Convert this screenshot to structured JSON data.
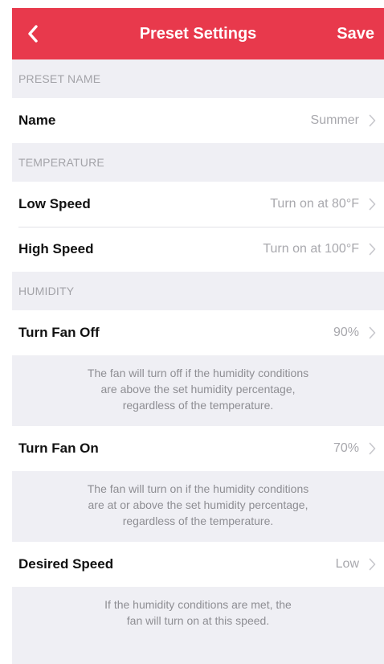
{
  "navbar": {
    "title": "Preset Settings",
    "save_label": "Save",
    "back_icon": "chevron-left-icon",
    "color": "#e8394c"
  },
  "sections": {
    "preset_name": {
      "header": "PRESET NAME",
      "name_label": "Name",
      "name_value": "Summer"
    },
    "temperature": {
      "header": "TEMPERATURE",
      "low_label": "Low Speed",
      "low_value": "Turn on at 80°F",
      "high_label": "High Speed",
      "high_value": "Turn on at 100°F"
    },
    "humidity": {
      "header": "HUMIDITY",
      "off_label": "Turn Fan Off",
      "off_value": "90%",
      "off_note_1": "The fan will turn off if the humidity conditions",
      "off_note_2": "are above the set humidity percentage,",
      "off_note_3": "regardless of the temperature.",
      "on_label": "Turn Fan On",
      "on_value": "70%",
      "on_note_1": "The fan will turn on if the humidity conditions",
      "on_note_2": "are at or above the set humidity percentage,",
      "on_note_3": "regardless of the temperature.",
      "speed_label": "Desired Speed",
      "speed_value": "Low",
      "speed_note_1": "If the humidity conditions are met, the",
      "speed_note_2": "fan will turn on at this speed."
    }
  }
}
